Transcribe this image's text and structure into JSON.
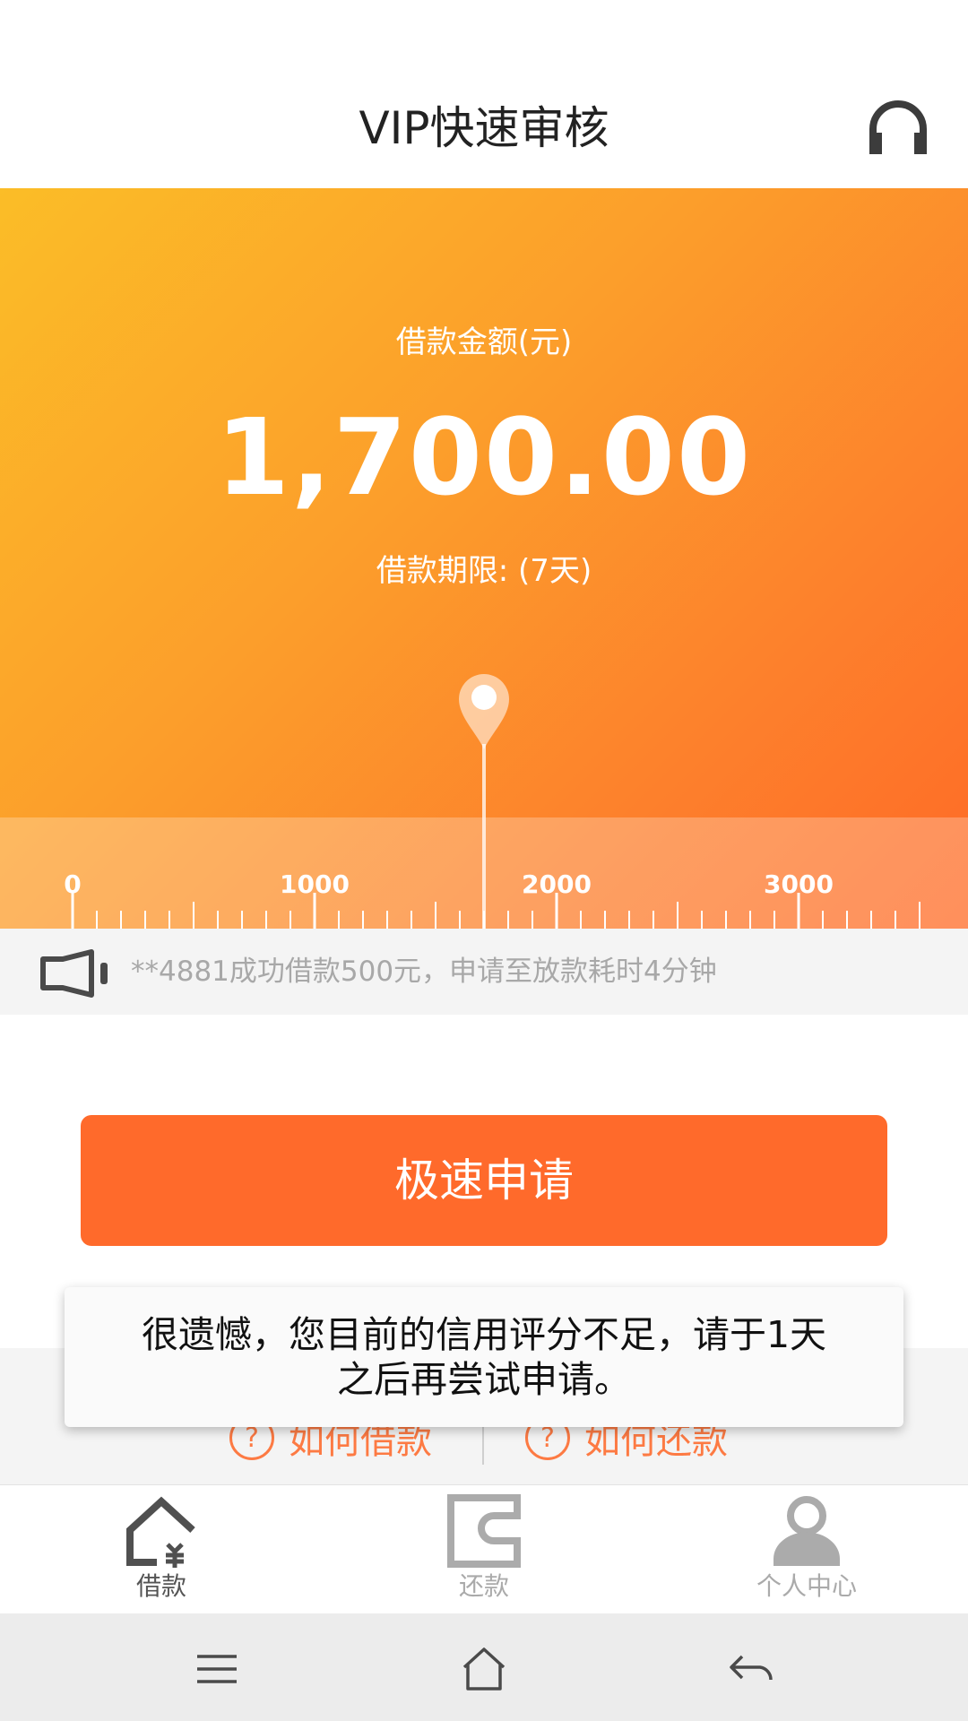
{
  "header": {
    "title": "VIP快速审核",
    "support_icon": "headset-icon"
  },
  "hero": {
    "amount_label": "借款金额(元)",
    "amount": "1,700.00",
    "term_label": "借款期限: (7天)",
    "slider_value": 1700,
    "ruler": {
      "min": 0,
      "max": 3500,
      "tick_labels": [
        "0",
        "1000",
        "2000",
        "3000"
      ]
    },
    "colors": {
      "gradient_start": "#fbbd27",
      "gradient_end": "#ff6a26"
    }
  },
  "notice": {
    "icon": "speaker-icon",
    "text": "**4881成功借款500元，申请至放款耗时4分钟"
  },
  "apply_button": {
    "label": "极速申请",
    "color": "#ff6a2b"
  },
  "help": {
    "how_to_borrow": "如何借款",
    "how_to_repay": "如何还款",
    "icon": "question-icon"
  },
  "toast": {
    "line1": "很遗憾，您目前的信用评分不足，请于1天",
    "line2": "之后再尝试申请。"
  },
  "tabbar": {
    "items": [
      {
        "label": "借款",
        "icon": "home-loan-icon",
        "active": true
      },
      {
        "label": "还款",
        "icon": "wallet-icon",
        "active": false
      },
      {
        "label": "个人中心",
        "icon": "user-icon",
        "active": false
      }
    ]
  },
  "system_nav": {
    "menu_icon": "menu-icon",
    "home_icon": "home-icon",
    "back_icon": "back-icon"
  }
}
